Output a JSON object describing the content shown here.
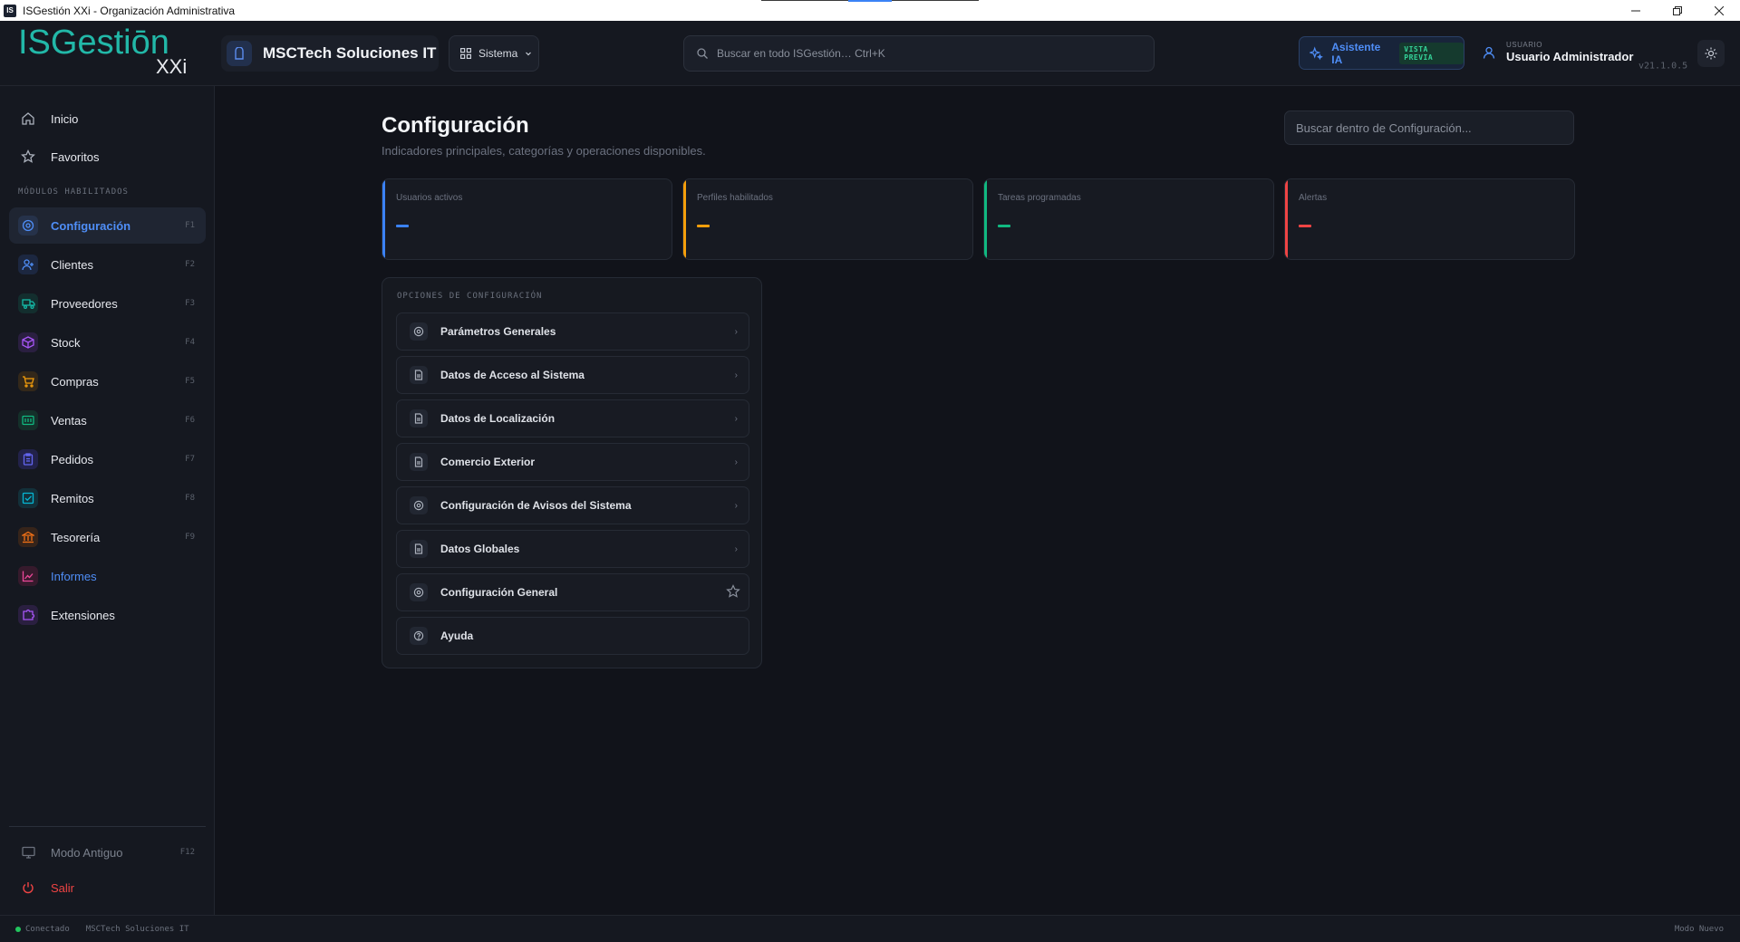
{
  "window": {
    "icon_text": "IS",
    "title": "ISGestión XXi - Organización Administrativa"
  },
  "header": {
    "logo_text": "ISGestiōn",
    "logo_sub": "XXi",
    "org_name": "MSCTech Soluciones IT",
    "system_menu": "Sistema",
    "search_placeholder": "Buscar en todo ISGestión…  Ctrl+K",
    "ai_label": "Asistente IA",
    "ai_badge": "VISTA PREVIA",
    "user_caption": "USUARIO",
    "user_name": "Usuario Administrador",
    "version": "v21.1.0.5"
  },
  "sidebar": {
    "top_items": [
      {
        "label": "Inicio",
        "icon": "home-icon"
      },
      {
        "label": "Favoritos",
        "icon": "star-icon"
      }
    ],
    "section_title": "MÓDULOS HABILITADOS",
    "items": [
      {
        "label": "Configuración",
        "key": "F1",
        "icon": "settings-icon",
        "color": "#4f8ef7",
        "active": true
      },
      {
        "label": "Clientes",
        "key": "F2",
        "icon": "user-add-icon",
        "color": "#4f8ef7"
      },
      {
        "label": "Proveedores",
        "key": "F3",
        "icon": "truck-icon",
        "color": "#14b8a6"
      },
      {
        "label": "Stock",
        "key": "F4",
        "icon": "box-icon",
        "color": "#a855f7"
      },
      {
        "label": "Compras",
        "key": "F5",
        "icon": "cart-icon",
        "color": "#f59e0b"
      },
      {
        "label": "Ventas",
        "key": "F6",
        "icon": "sales-icon",
        "color": "#10b981"
      },
      {
        "label": "Pedidos",
        "key": "F7",
        "icon": "clipboard-icon",
        "color": "#6366f1"
      },
      {
        "label": "Remitos",
        "key": "F8",
        "icon": "check-square-icon",
        "color": "#06b6d4"
      },
      {
        "label": "Tesorería",
        "key": "F9",
        "icon": "bank-icon",
        "color": "#f97316"
      },
      {
        "label": "Informes",
        "key": "",
        "icon": "chart-line-icon",
        "color": "#ec4899"
      },
      {
        "label": "Extensiones",
        "key": "",
        "icon": "puzzle-icon",
        "color": "#a855f7"
      }
    ],
    "legacy_mode": {
      "label": "Modo Antiguo",
      "key": "F12"
    },
    "logout": {
      "label": "Salir"
    }
  },
  "main": {
    "title": "Configuración",
    "subtitle": "Indicadores principales, categorías y operaciones disponibles.",
    "local_search_placeholder": "Buscar dentro de Configuración...",
    "stats": [
      {
        "label": "Usuarios activos",
        "color": "#3b82f6"
      },
      {
        "label": "Perfiles habilitados",
        "color": "#f59e0b"
      },
      {
        "label": "Tareas programadas",
        "color": "#10b981"
      },
      {
        "label": "Alertas",
        "color": "#ef4444"
      }
    ],
    "options_title": "OPCIONES DE CONFIGURACIÓN",
    "options": [
      {
        "label": "Parámetros Generales",
        "icon": "settings-icon",
        "trail": "chevron"
      },
      {
        "label": "Datos de Acceso al Sistema",
        "icon": "document-icon",
        "trail": "chevron"
      },
      {
        "label": "Datos de Localización",
        "icon": "document-icon",
        "trail": "chevron"
      },
      {
        "label": "Comercio Exterior",
        "icon": "document-icon",
        "trail": "chevron"
      },
      {
        "label": "Configuración de Avisos del Sistema",
        "icon": "settings-icon",
        "trail": "chevron"
      },
      {
        "label": "Datos Globales",
        "icon": "document-icon",
        "trail": "chevron"
      },
      {
        "label": "Configuración General",
        "icon": "settings-icon",
        "trail": "star"
      },
      {
        "label": "Ayuda",
        "icon": "help-icon",
        "trail": "none"
      }
    ],
    "chevron_glyph": "›"
  },
  "status": {
    "connection": "Conectado",
    "org": "MSCTech Soluciones IT",
    "mode": "Modo Nuevo"
  }
}
